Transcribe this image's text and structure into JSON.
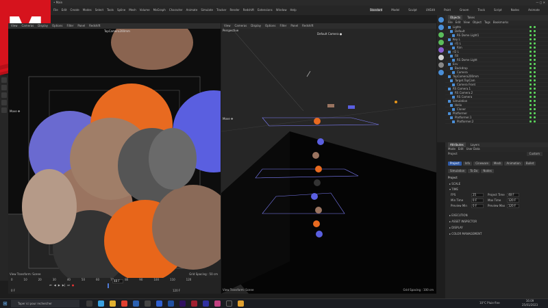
{
  "window": {
    "title": "• Main"
  },
  "menubar": {
    "items": [
      "File",
      "Edit",
      "Create",
      "Modes",
      "Select",
      "Tools",
      "Spline",
      "Mesh",
      "Volume",
      "MoGraph",
      "Character",
      "Animate",
      "Simulate",
      "Tracker",
      "Render",
      "Redshift",
      "Extensions",
      "Window",
      "Help"
    ]
  },
  "layouts": {
    "items": [
      "Standard",
      "Model",
      "Sculpt",
      "UVEdit",
      "Paint",
      "Groom",
      "Track",
      "Script",
      "Nodes",
      "Animate",
      "+"
    ]
  },
  "viewport_left": {
    "menu": [
      "View",
      "Cameras",
      "Display",
      "Options",
      "Filter",
      "Panel",
      "Redshift"
    ],
    "camera": "TopCamera200mm",
    "move": "Move ✥",
    "status_left": "View Transform: Scene",
    "status_right": "Grid Spacing : 50 cm"
  },
  "viewport_right": {
    "menu": [
      "View",
      "Cameras",
      "Display",
      "Options",
      "Filter",
      "Panel",
      "Redshift"
    ],
    "label": "Perspective",
    "camera": "Default Camera ●",
    "move": "Move ✥",
    "status_left": "View Transform: Scene",
    "status_right": "Grid Spacing : 100 cm"
  },
  "objects": {
    "tabs": [
      "Objects",
      "Takes"
    ],
    "menu": [
      "File",
      "Edit",
      "View",
      "Object",
      "Tags",
      "Bookmarks"
    ],
    "rows": [
      "Lights",
      "Default",
      "RS Dome Light1",
      "Key L",
      "rl1 L",
      "Rim",
      "rl2 L",
      "Fill",
      "RS Dome Light",
      "Env",
      "Backdrop",
      "Camera",
      "TopCamera200mm",
      "Target.TopCam",
      "Camera Front",
      "RS Camera.1",
      "RS Camera.2",
      "RS Camera",
      "Simulation",
      "Helix",
      "Cloner",
      "Platformer",
      "Platformer.1",
      "Platformer.2"
    ]
  },
  "attributes": {
    "tabs": [
      "Attributes",
      "Layers"
    ],
    "menu": [
      "Mode",
      "Edit",
      "User Data"
    ],
    "section": "Project",
    "preset": "Custom",
    "buttons": [
      "Project",
      "Info",
      "Cineware",
      "Mesh",
      "Animation",
      "Bullet",
      "Simulation",
      "To Do",
      "Nodes"
    ],
    "active_button": "Project",
    "heading": "Project",
    "groups": [
      "SCALE",
      "TIME",
      "EXECUTION",
      "ASSET INSPECTOR",
      "DISPLAY",
      "COLOR MANAGEMENT"
    ],
    "time": {
      "fps_label": "FPS",
      "fps": "25",
      "project_time_label": "Project Time",
      "project_time": "48 F",
      "min_time_label": "Min Time",
      "min_time": "0 F",
      "max_time_label": "Max Time",
      "max_time": "120 F",
      "preview_min_label": "Preview Min",
      "preview_min": "0 F",
      "preview_max_label": "Preview Max",
      "preview_max": "120 F"
    }
  },
  "timeline": {
    "frame": "48 F",
    "start": "0 F",
    "end": "120 F",
    "ticks": [
      "0",
      "10",
      "20",
      "30",
      "40",
      "50",
      "60",
      "70",
      "80",
      "90",
      "100",
      "110",
      "120"
    ]
  },
  "taskbar": {
    "search_placeholder": "Taper ici pour rechercher",
    "weather": "10°C  Pluie fine",
    "time": "16:09",
    "date": "25/01/2023"
  }
}
